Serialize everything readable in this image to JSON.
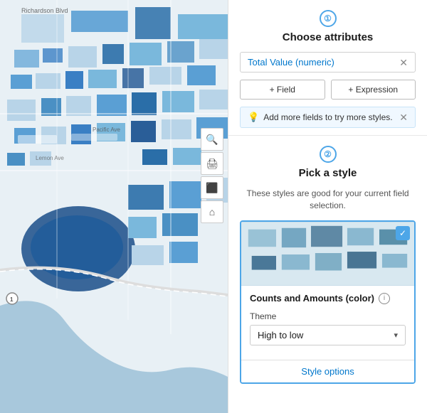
{
  "map": {
    "aria_label": "Map view"
  },
  "toolbar": {
    "tools": [
      {
        "name": "search",
        "icon": "🔍"
      },
      {
        "name": "print",
        "icon": "🖨"
      },
      {
        "name": "monitor",
        "icon": "🖥"
      },
      {
        "name": "home",
        "icon": "⌂"
      }
    ]
  },
  "section1": {
    "step": "①",
    "title": "Choose attributes",
    "attribute": "Total Value (numeric)",
    "field_btn": "+ Field",
    "expression_btn": "+ Expression",
    "info_text": "Add more fields to try more styles."
  },
  "section2": {
    "step": "②",
    "title": "Pick a style",
    "subtitle": "These styles are good for your current field selection.",
    "card": {
      "title": "Counts and Amounts (color)",
      "theme_label": "Theme",
      "theme_value": "High to low",
      "style_options": "Style options"
    }
  }
}
